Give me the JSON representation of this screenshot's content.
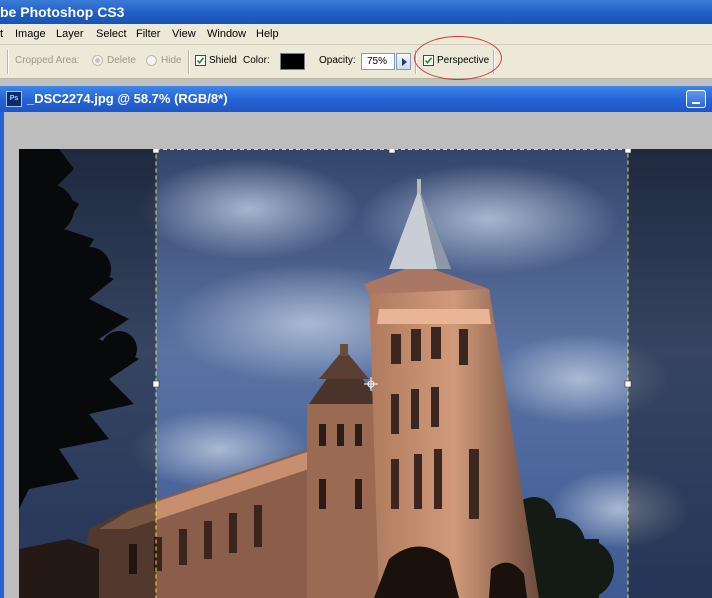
{
  "app": {
    "title": "be Photoshop CS3"
  },
  "menu": {
    "items": [
      "t",
      "Image",
      "Layer",
      "Select",
      "Filter",
      "View",
      "Window",
      "Help"
    ]
  },
  "options": {
    "cropped_area_label": "Cropped Area:",
    "delete_label": "Delete",
    "hide_label": "Hide",
    "shield_label": "Shield",
    "color_label": "Color:",
    "shield_color": "#000000",
    "opacity_label": "Opacity:",
    "opacity_value": "75%",
    "perspective_label": "Perspective"
  },
  "document": {
    "title": "_DSC2274.jpg @ 58.7% (RGB/8*)"
  },
  "colors": {
    "highlight": "#d23b3b",
    "title_bar": "#2462d6"
  }
}
